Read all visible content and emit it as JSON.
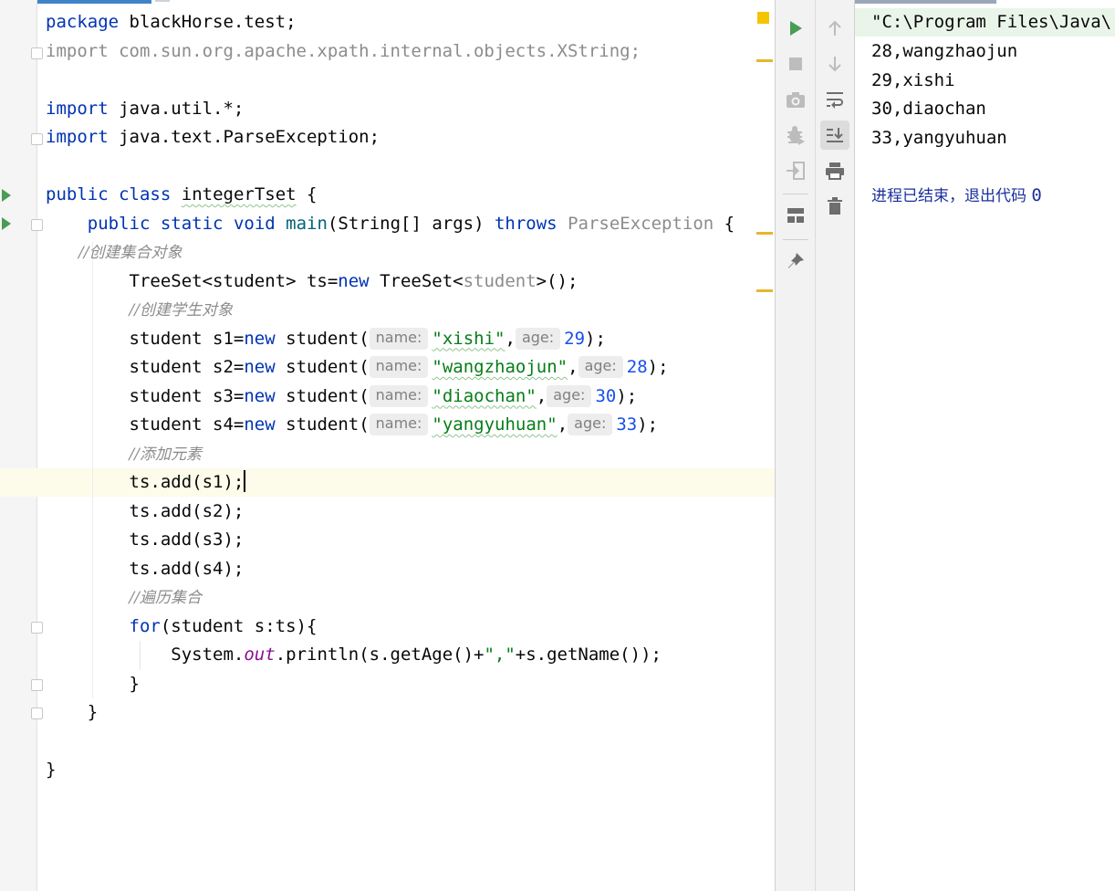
{
  "editor": {
    "lines": {
      "l1": {
        "kw": "package",
        "rest": " blackHorse.test;"
      },
      "l2": {
        "text": "import com.sun.org.apache.xpath.internal.objects.XString;"
      },
      "l4": {
        "kw": "import",
        "rest": " java.util.*;"
      },
      "l5": {
        "kw": "import",
        "rest": " java.text.ParseException;"
      },
      "l7": {
        "kw1": "public",
        "kw2": "class",
        "name": "integerTset",
        "brace": " {"
      },
      "l8": {
        "kw1": "public",
        "kw2": "static",
        "kw3": "void",
        "method": "main",
        "params": "(String[] args) ",
        "kw4": "throws",
        "exc": "ParseException",
        "brace": " {"
      },
      "l9": {
        "comment": "//创建集合对象"
      },
      "l10": {
        "a": "TreeSet<student> ts=",
        "kw": "new",
        "b": " TreeSet<",
        "generic": "student",
        "c": ">();"
      },
      "l11": {
        "comment": "//创建学生对象"
      },
      "l12": {
        "a": "student s1=",
        "kw": "new",
        "b": " student(",
        "hint1": "name:",
        "str": "\"xishi\"",
        "comma": ",",
        "hint2": "age:",
        "num": "29",
        "end": ");"
      },
      "l13": {
        "a": "student s2=",
        "kw": "new",
        "b": " student(",
        "hint1": "name:",
        "str": "\"wangzhaojun\"",
        "comma": ",",
        "hint2": "age:",
        "num": "28",
        "end": ");"
      },
      "l14": {
        "a": "student s3=",
        "kw": "new",
        "b": " student(",
        "hint1": "name:",
        "str": "\"diaochan\"",
        "comma": ",",
        "hint2": "age:",
        "num": "30",
        "end": ");"
      },
      "l15": {
        "a": "student s4=",
        "kw": "new",
        "b": " student(",
        "hint1": "name:",
        "str": "\"yangyuhuan\"",
        "comma": ",",
        "hint2": "age:",
        "num": "33",
        "end": ");"
      },
      "l16": {
        "comment": "//添加元素"
      },
      "l17": {
        "text": "ts.add(s1);"
      },
      "l18": {
        "text": "ts.add(s2);"
      },
      "l19": {
        "text": "ts.add(s3);"
      },
      "l20": {
        "text": "ts.add(s4);"
      },
      "l21": {
        "comment": "//遍历集合"
      },
      "l22": {
        "kw": "for",
        "rest": "(student s:ts){"
      },
      "l23": {
        "a": "System.",
        "field": "out",
        "b": ".println(s.getAge()+",
        "str": "\",\"",
        "c": "+s.getName());"
      },
      "l24": {
        "text": "}"
      },
      "l25": {
        "text": "}"
      },
      "l27": {
        "text": "}"
      }
    }
  },
  "toolbar": {
    "icons": [
      "run-icon",
      "stop-icon",
      "camera-icon",
      "debug-icon",
      "login-icon",
      "layout-icon",
      "pin-icon",
      "up-arrow-icon",
      "down-arrow-icon",
      "soft-wrap-icon",
      "scroll-to-end-icon",
      "print-icon",
      "trash-icon"
    ]
  },
  "console": {
    "command": "\"C:\\Program Files\\Java\\",
    "output": [
      "28,wangzhaojun",
      "29,xishi",
      "30,diaochan",
      "33,yangyuhuan"
    ],
    "exit_text": "进程已结束，退出代码 ",
    "exit_code": "0"
  },
  "colors": {
    "keyword": "#0033b3",
    "string": "#067d17",
    "number": "#1750eb",
    "comment": "#8c8c8c",
    "run_green": "#499c54",
    "current_line": "#fdfbea"
  }
}
